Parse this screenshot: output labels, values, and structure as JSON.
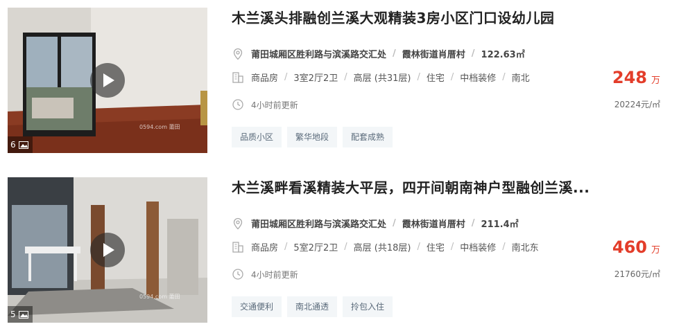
{
  "listings": [
    {
      "title": "木兰溪头排融创兰溪大观精装3房小区门口设幼儿园",
      "address": "莆田城厢区胜利路与滨溪路交汇处",
      "area_name": "霞林街道肖厝村",
      "size": "122.63㎡",
      "specs": [
        "商品房",
        "3室2厅2卫",
        "高层 (共31层)",
        "住宅",
        "中档装修",
        "南北"
      ],
      "updated": "4小时前更新",
      "price": "248",
      "price_unit": "万",
      "unit_price": "20224元/㎡",
      "tags": [
        "品质小区",
        "繁华地段",
        "配套成熟"
      ],
      "photo_count": "6",
      "watermark": "0594.com 莆田"
    },
    {
      "title": "木兰溪畔看溪精装大平层，四开间朝南神户型融创兰溪...",
      "address": "莆田城厢区胜利路与滨溪路交汇处",
      "area_name": "霞林街道肖厝村",
      "size": "211.4㎡",
      "specs": [
        "商品房",
        "5室2厅2卫",
        "高层 (共18层)",
        "住宅",
        "中档装修",
        "南北东"
      ],
      "updated": "4小时前更新",
      "price": "460",
      "price_unit": "万",
      "unit_price": "21760元/㎡",
      "tags": [
        "交通便利",
        "南北通透",
        "拎包入住"
      ],
      "photo_count": "5",
      "watermark": "0594.com 莆田"
    }
  ],
  "colors": {
    "price": "#e33d2a",
    "tag_bg": "#f3f6f8",
    "tag_text": "#5a6a7a"
  },
  "icons": {
    "location": "location-pin-icon",
    "building": "building-icon",
    "clock": "clock-icon",
    "photo": "image-icon",
    "play": "play-icon"
  }
}
